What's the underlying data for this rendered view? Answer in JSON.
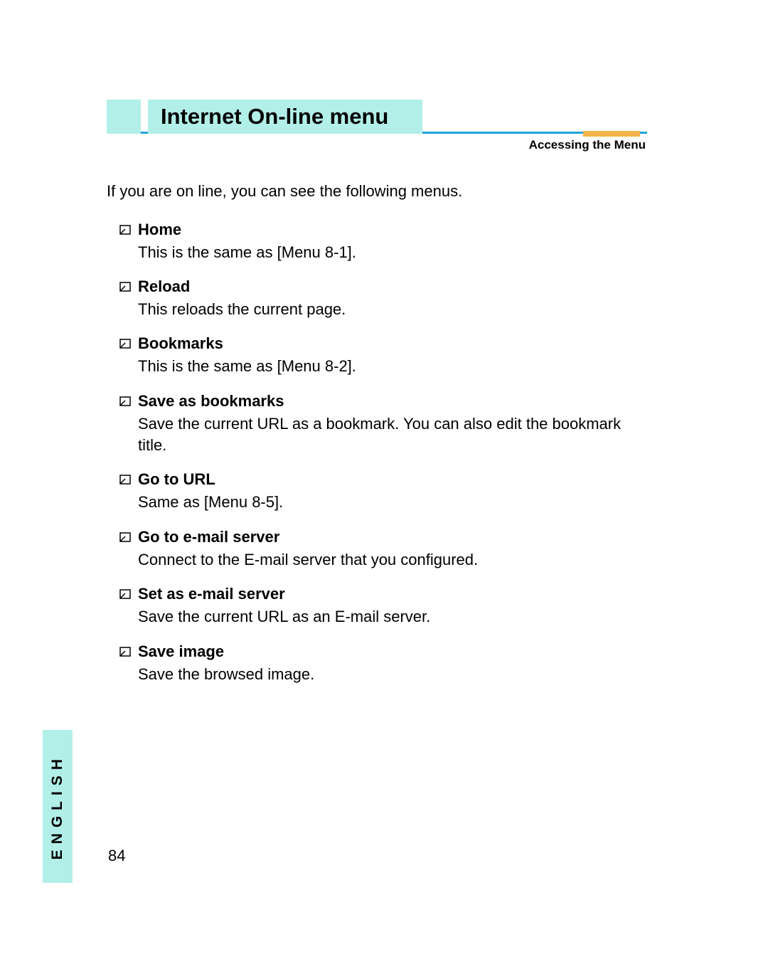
{
  "title": "Internet On-line menu",
  "subtitle": "Accessing the Menu",
  "intro": "If you are on line, you can see the following menus.",
  "items": [
    {
      "label": "Home",
      "desc": "This is the same as [Menu 8-1]."
    },
    {
      "label": "Reload",
      "desc": "This reloads the current page."
    },
    {
      "label": "Bookmarks",
      "desc": "This is the same as [Menu 8-2]."
    },
    {
      "label": "Save as bookmarks",
      "desc": "Save the current URL as a bookmark. You can also edit the bookmark title."
    },
    {
      "label": "Go to URL",
      "desc": "Same as [Menu 8-5]."
    },
    {
      "label": "Go to e-mail server",
      "desc": "Connect to the E-mail server that you configured."
    },
    {
      "label": "Set as e-mail server",
      "desc": "Save the current URL as an E-mail server."
    },
    {
      "label": "Save image",
      "desc": "Save the browsed image."
    }
  ],
  "sideTab": "ENGLISH",
  "pageNumber": "84"
}
